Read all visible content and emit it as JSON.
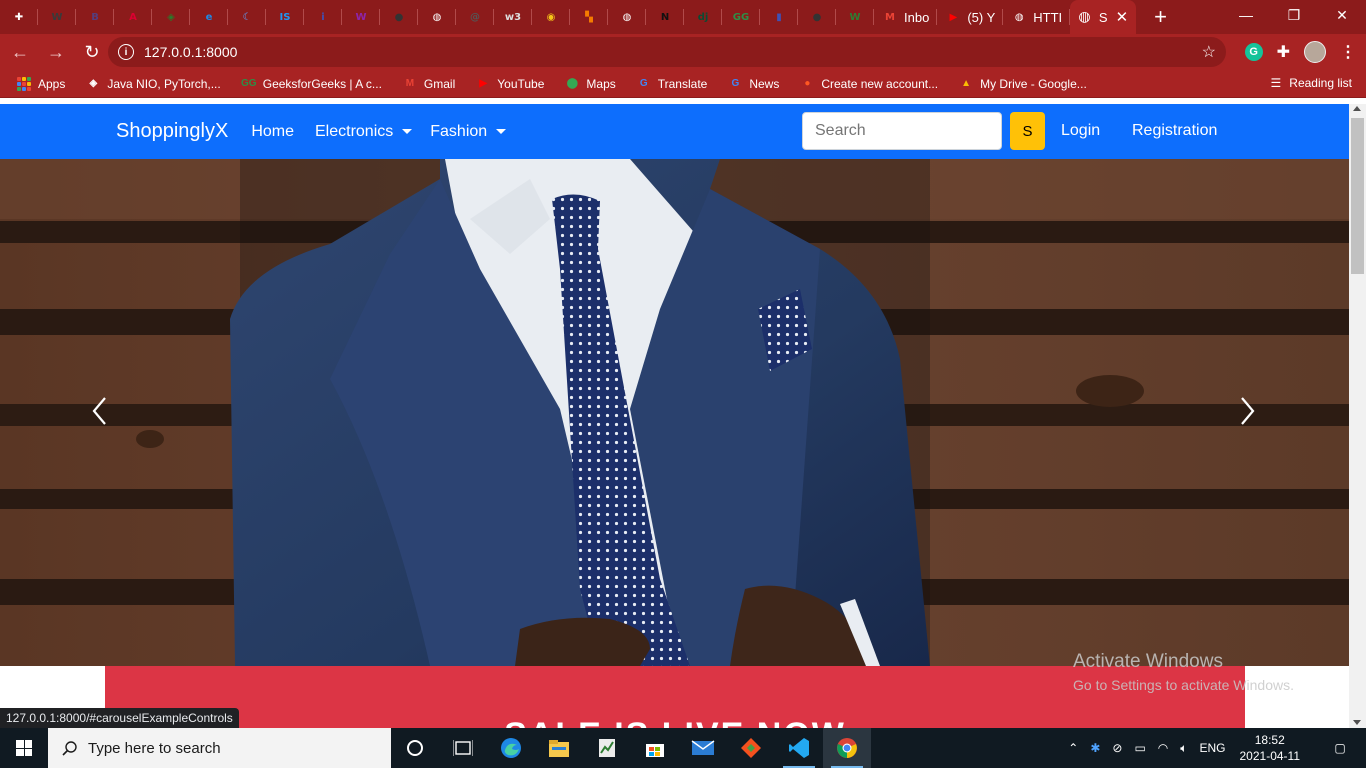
{
  "browser": {
    "pinned_tabs": [
      {
        "icon": "puzzle-tab-icon",
        "glyph": "✚",
        "color": "#ffffff"
      },
      {
        "icon": "wp-tab-icon",
        "glyph": "W",
        "color": "#3a3a3a"
      },
      {
        "icon": "bootstrap-tab-icon",
        "glyph": "B",
        "color": "#563d7c"
      },
      {
        "icon": "angular-tab-icon",
        "glyph": "A",
        "color": "#dd0031"
      },
      {
        "icon": "diamond-tab-icon",
        "glyph": "◈",
        "color": "#2a7a2a"
      },
      {
        "icon": "edge-tab-icon",
        "glyph": "e",
        "color": "#1e88e5"
      },
      {
        "icon": "moon-tab-icon",
        "glyph": "☾",
        "color": "#5da3ff"
      },
      {
        "icon": "is-tab-icon",
        "glyph": "IS",
        "color": "#2196f3"
      },
      {
        "icon": "info-tab-icon",
        "glyph": "i",
        "color": "#3f51b5"
      },
      {
        "icon": "w-purple-tab-icon",
        "glyph": "W",
        "color": "#8e24aa"
      },
      {
        "icon": "github-tab-icon",
        "glyph": "●",
        "color": "#333333"
      },
      {
        "icon": "globe-tab-icon",
        "glyph": "◍",
        "color": "#ffffff"
      },
      {
        "icon": "swirl-tab-icon",
        "glyph": "@",
        "color": "#555555"
      },
      {
        "icon": "w3schools-tab-icon",
        "glyph": "w3",
        "color": "#dddddd"
      },
      {
        "icon": "chrome-tab-icon",
        "glyph": "◉",
        "color": "#f5c518"
      },
      {
        "icon": "analytics-tab-icon",
        "glyph": "▚",
        "color": "#f57c00"
      },
      {
        "icon": "globe-tab-icon-2",
        "glyph": "◍",
        "color": "#ffffff"
      },
      {
        "icon": "n-tab-icon",
        "glyph": "N",
        "color": "#111111"
      },
      {
        "icon": "django-tab-icon",
        "glyph": "dj",
        "color": "#0c4b33"
      },
      {
        "icon": "gfg-tab-icon",
        "glyph": "GG",
        "color": "#2f8d46"
      },
      {
        "icon": "book-tab-icon",
        "glyph": "▮",
        "color": "#3f51b5"
      },
      {
        "icon": "github-tab-icon-2",
        "glyph": "●",
        "color": "#333333"
      },
      {
        "icon": "w-green-tab-icon",
        "glyph": "W",
        "color": "#2e7d32"
      }
    ],
    "named_tabs": [
      {
        "icon": "gmail-tab-icon",
        "glyph": "M",
        "color": "#ea4335",
        "label": "Inbo"
      },
      {
        "icon": "youtube-tab-icon",
        "glyph": "▶",
        "color": "#ff0000",
        "label": "(5) Y"
      },
      {
        "icon": "globe-tab-icon-3",
        "glyph": "◍",
        "color": "#ffffff",
        "label": "HTTI"
      }
    ],
    "active_tab": {
      "label": "S",
      "close": "✕"
    },
    "new_tab": "+",
    "window_controls": {
      "minimize": "—",
      "maximize": "❐",
      "close": "✕"
    },
    "url": "127.0.0.1:8000",
    "bookmarks": [
      {
        "label": "Apps",
        "icon": "apps-grid-icon",
        "color": "#ffffff"
      },
      {
        "label": "Java NIO, PyTorch,...",
        "icon": "diamond-bookmark-icon",
        "glyph": "◈",
        "color": "#ffffff"
      },
      {
        "label": "GeeksforGeeks | A c...",
        "icon": "gfg-bookmark-icon",
        "glyph": "GG",
        "color": "#2f8d46"
      },
      {
        "label": "Gmail",
        "icon": "gmail-bookmark-icon",
        "glyph": "M",
        "color": "#ea4335"
      },
      {
        "label": "YouTube",
        "icon": "youtube-bookmark-icon",
        "glyph": "▶",
        "color": "#ff0000"
      },
      {
        "label": "Maps",
        "icon": "maps-bookmark-icon",
        "glyph": "⬤",
        "color": "#34a853"
      },
      {
        "label": "Translate",
        "icon": "translate-bookmark-icon",
        "glyph": "G",
        "color": "#4285f4"
      },
      {
        "label": "News",
        "icon": "news-bookmark-icon",
        "glyph": "G",
        "color": "#4285f4"
      },
      {
        "label": "Create new account...",
        "icon": "create-account-bookmark-icon",
        "glyph": "●",
        "color": "#ff5722"
      },
      {
        "label": "My Drive - Google...",
        "icon": "drive-bookmark-icon",
        "glyph": "▲",
        "color": "#fbbc04"
      }
    ],
    "reading_list": "Reading list",
    "ext_grammarly": "G"
  },
  "site": {
    "brand": "ShoppinglyX",
    "nav": {
      "home": "Home",
      "electronics": "Electronics",
      "fashion": "Fashion"
    },
    "search": {
      "placeholder": "Search",
      "button": "S"
    },
    "login": "Login",
    "registration": "Registration",
    "banner_heading": "SALE IS LIVE NOW",
    "colors": {
      "navbar": "#0d6efd",
      "search_button": "#ffc107",
      "banner": "#dc3545"
    }
  },
  "overlays": {
    "activate_title": "Activate Windows",
    "activate_sub": "Go to Settings to activate Windows.",
    "status_url": "127.0.0.1:8000/#carouselExampleControls"
  },
  "taskbar": {
    "search_placeholder": "Type here to search",
    "tray_lang": "ENG",
    "time": "18:52",
    "date": "2021-04-11"
  }
}
